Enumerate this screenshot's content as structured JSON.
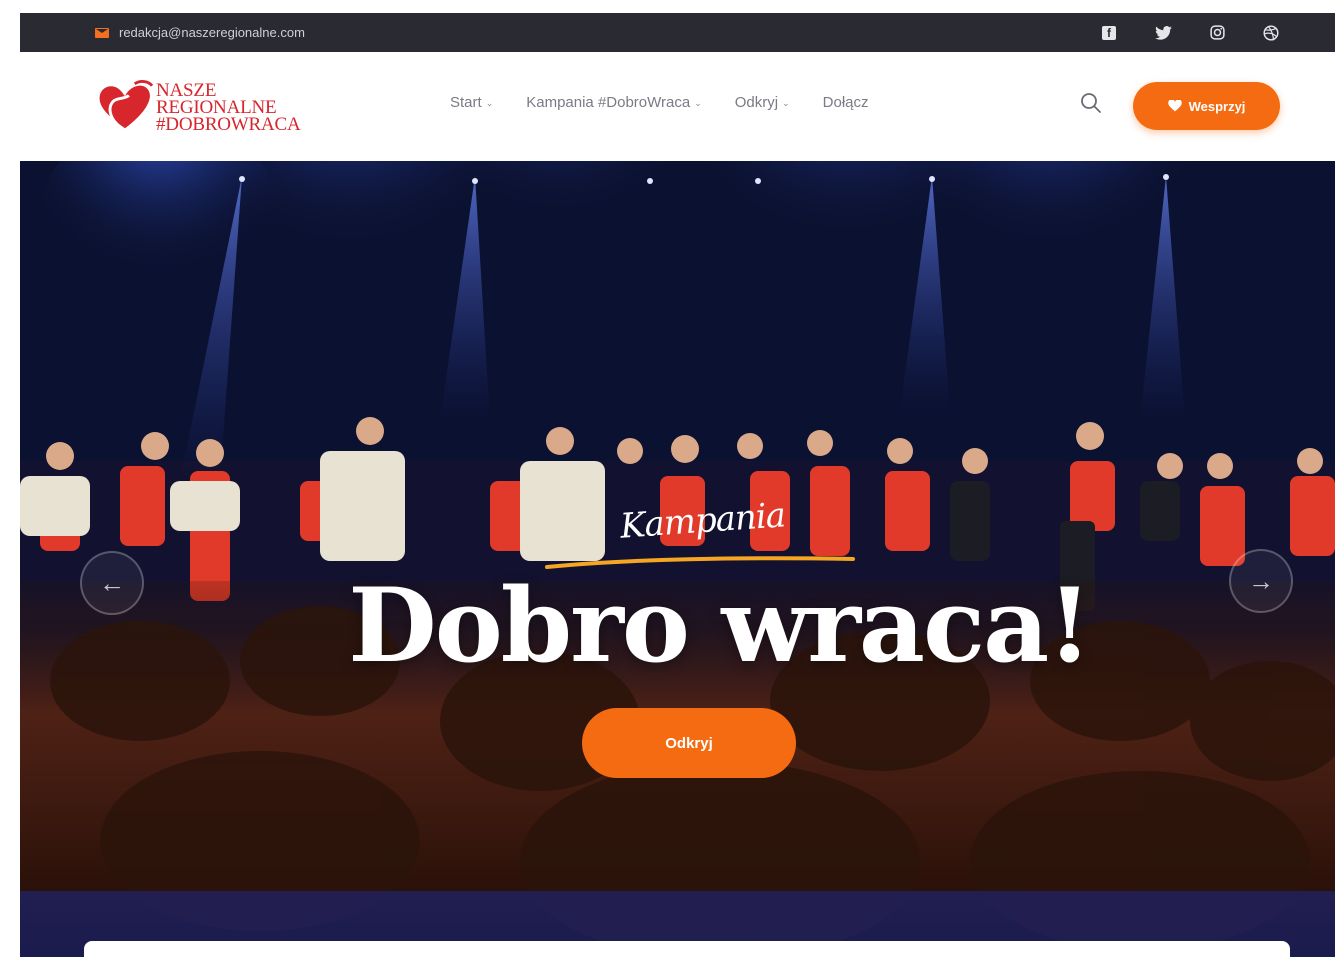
{
  "topbar": {
    "email": "redakcja@naszeregionalne.com",
    "socials": [
      "facebook-icon",
      "twitter-icon",
      "instagram-icon",
      "dribbble-icon"
    ]
  },
  "logo": {
    "line1": "NASZE",
    "line2": "REGIONALNE",
    "line3": "#DOBROWRACA"
  },
  "nav": {
    "items": [
      {
        "label": "Start"
      },
      {
        "label": "Kampania #DobroWraca"
      },
      {
        "label": "Odkryj"
      },
      {
        "label": "Dołącz"
      }
    ]
  },
  "header": {
    "donate_label": "Wesprzyj"
  },
  "hero": {
    "eyebrow": "Kampania",
    "headline": "Dobro wraca!",
    "cta_label": "Odkryj"
  },
  "colors": {
    "accent": "#f56b12",
    "brand_red": "#d8262d",
    "topbar_bg": "#2a2a33"
  }
}
